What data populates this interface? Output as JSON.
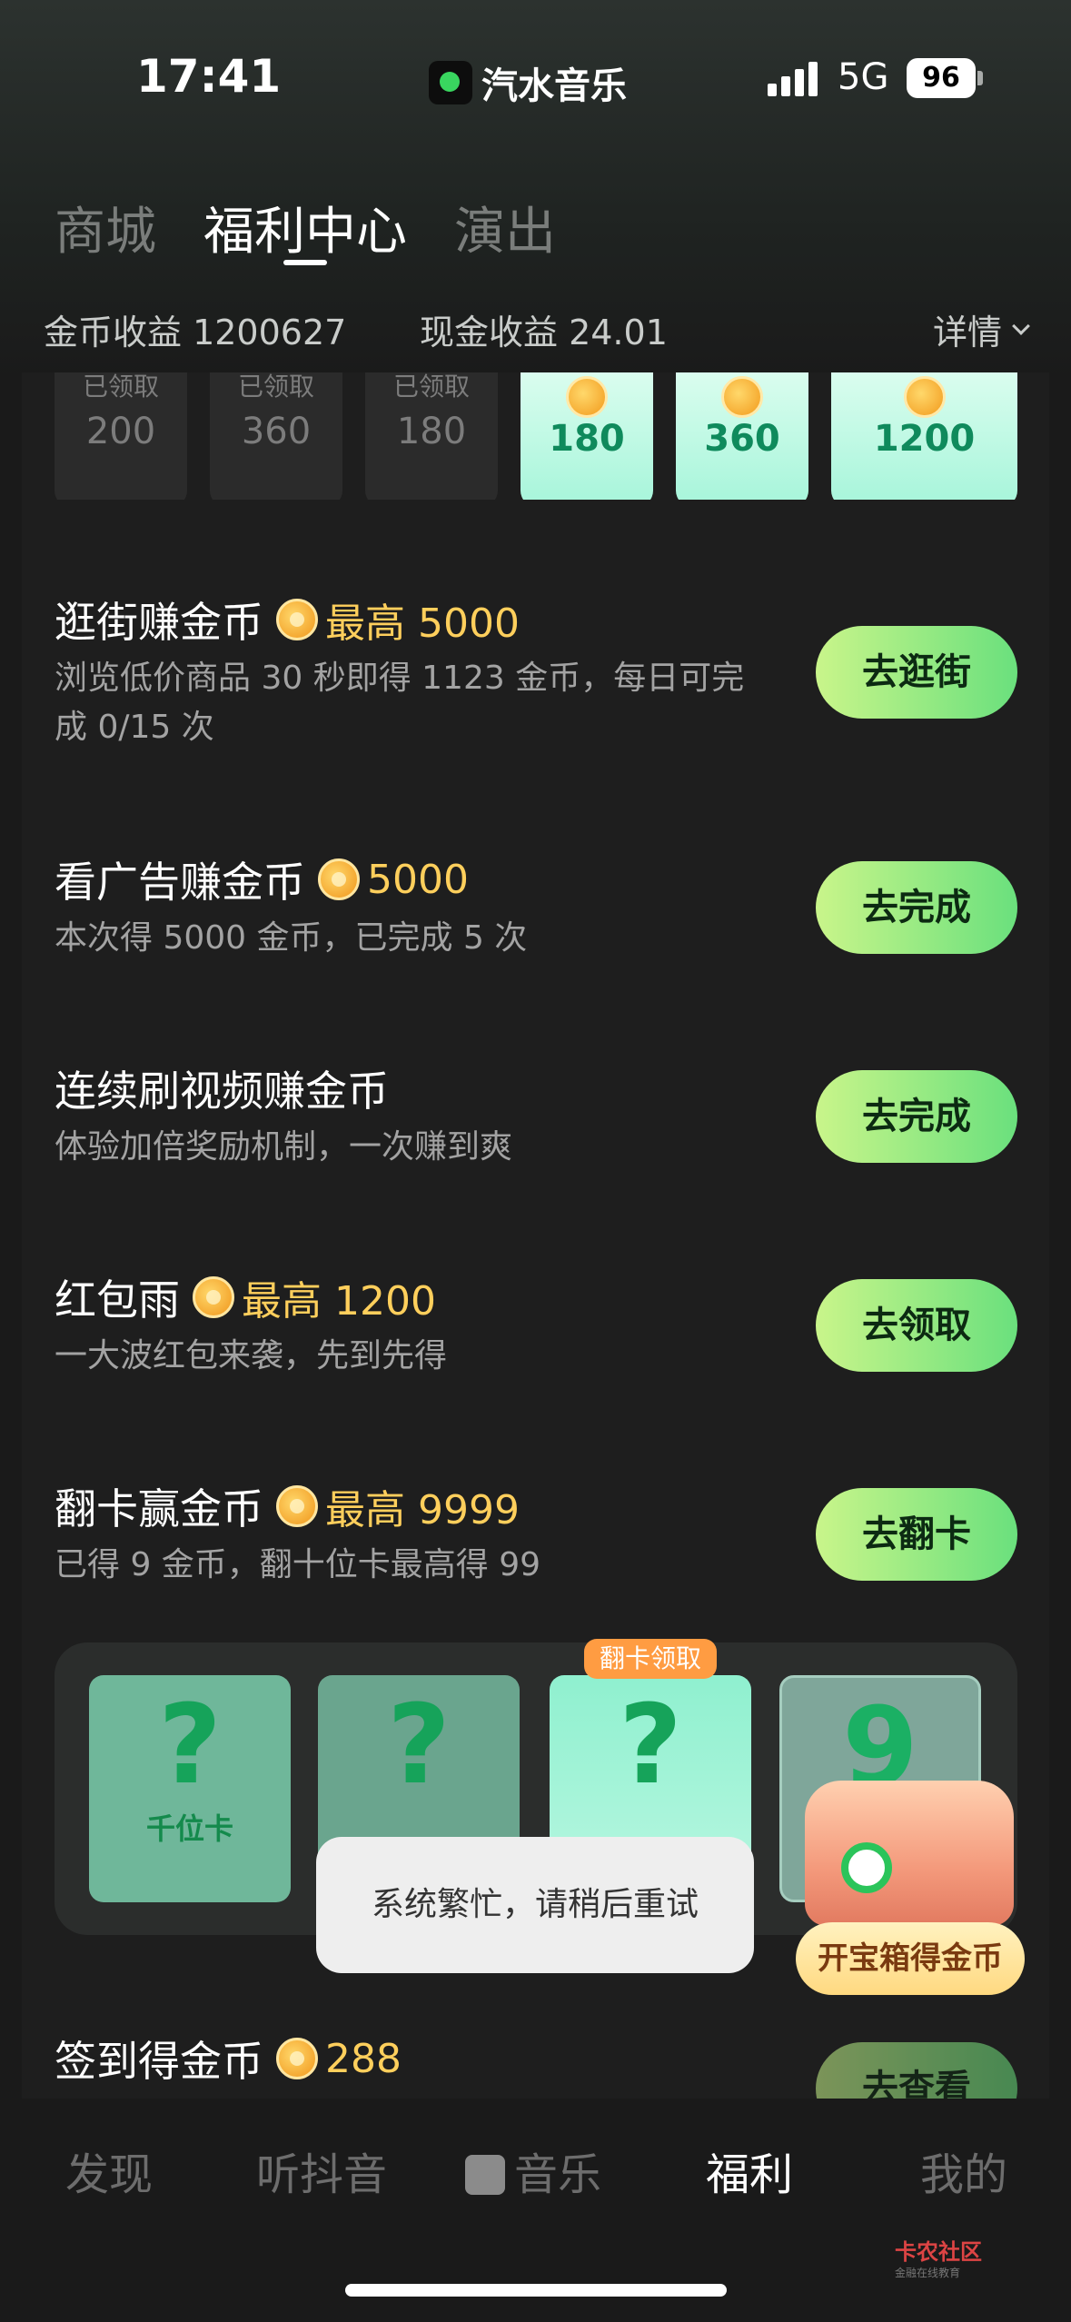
{
  "status": {
    "time": "17:41",
    "app_name": "汽水音乐",
    "network": "5G",
    "battery": "96"
  },
  "tabs": [
    {
      "label": "商城"
    },
    {
      "label": "福利中心"
    },
    {
      "label": "演出"
    }
  ],
  "earnings": {
    "coin_label": "金币收益 1200627",
    "cash_label": "现金收益 24.01",
    "detail": "详情"
  },
  "sign_days": [
    {
      "caption": "已领取",
      "amount": "200"
    },
    {
      "caption": "已领取",
      "amount": "360"
    },
    {
      "caption": "已领取",
      "amount": "180"
    },
    {
      "caption": "",
      "amount": "180"
    },
    {
      "caption": "",
      "amount": "360"
    },
    {
      "caption": "",
      "amount": "1200"
    }
  ],
  "tasks": [
    {
      "title": "逛街赚金币",
      "reward": "最高 5000",
      "desc": "浏览低价商品 30 秒即得 1123 金币，每日可完成 0/15 次",
      "button": "去逛街"
    },
    {
      "title": "看广告赚金币",
      "reward": "5000",
      "desc": "本次得 5000 金币，已完成 5 次",
      "button": "去完成"
    },
    {
      "title": "连续刷视频赚金币",
      "reward": "",
      "desc": "体验加倍奖励机制，一次赚到爽",
      "button": "去完成"
    },
    {
      "title": "红包雨",
      "reward": "最高 1200",
      "desc": "一大波红包来袭，先到先得",
      "button": "去领取"
    },
    {
      "title": "翻卡赢金币",
      "reward": "最高 9999",
      "desc": "已得 9 金币，翻十位卡最高得 99",
      "button": "去翻卡"
    },
    {
      "title": "签到得金币",
      "reward": "288",
      "desc": "",
      "button": "去查看"
    }
  ],
  "flip": {
    "tag": "翻卡领取",
    "cards": [
      {
        "symbol": "?",
        "label": "千位卡"
      },
      {
        "symbol": "?",
        "label": ""
      },
      {
        "symbol": "?",
        "label": ""
      },
      {
        "symbol": "9",
        "label": ""
      }
    ]
  },
  "toast": "系统繁忙，请稍后重试",
  "treasure": {
    "label": "开宝箱得金币"
  },
  "nav": [
    {
      "label": "发现"
    },
    {
      "label": "听抖音"
    },
    {
      "label": "音乐"
    },
    {
      "label": "福利"
    },
    {
      "label": "我的"
    }
  ],
  "watermark": {
    "main": "卡农社区",
    "sub": "金融在线教育"
  },
  "colors": {
    "accent_green": "#6ae07d",
    "coin_gold": "#ffcf5c",
    "background": "#1a1a1a"
  }
}
